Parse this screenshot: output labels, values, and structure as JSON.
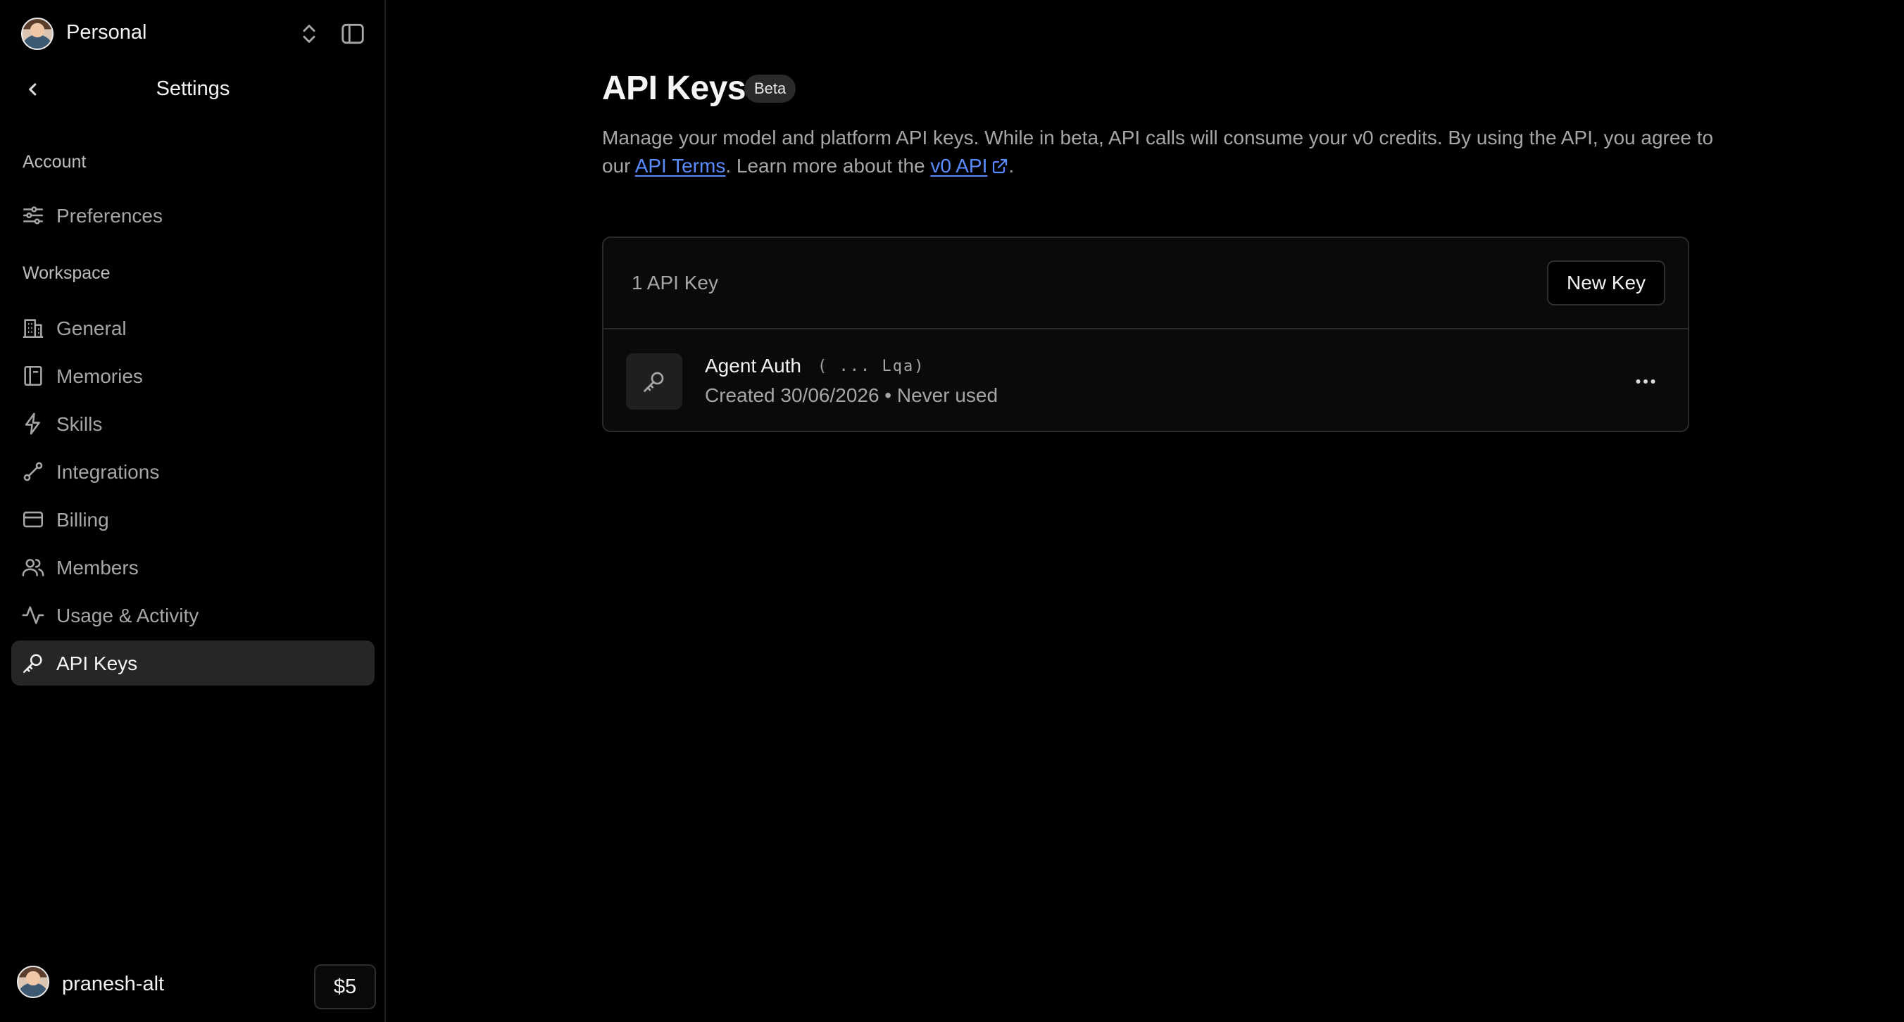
{
  "workspace": {
    "name": "Personal"
  },
  "settings": {
    "title": "Settings"
  },
  "sections": {
    "account": "Account",
    "workspace": "Workspace"
  },
  "nav": {
    "preferences": "Preferences",
    "general": "General",
    "memories": "Memories",
    "skills": "Skills",
    "integrations": "Integrations",
    "billing": "Billing",
    "members": "Members",
    "usage": "Usage & Activity",
    "api_keys": "API Keys"
  },
  "user": {
    "name": "pranesh-alt",
    "credits": "$5"
  },
  "page": {
    "title": "API Keys",
    "badge": "Beta",
    "desc_part1": "Manage your model and platform API keys. While in beta, API calls will consume your v0 credits. By using the API, you agree to our ",
    "link_terms": "API Terms",
    "desc_part2": ". Learn more about the ",
    "link_api": "v0 API",
    "desc_part3": "."
  },
  "keys": {
    "count_label": "1 API Key",
    "new_button": "New Key",
    "items": [
      {
        "name": "Agent Auth",
        "suffix": "( ... Lqa)",
        "meta": "Created 30/06/2026 • Never used"
      }
    ]
  },
  "icons": {
    "workspace_switch": "chevron-up-down-icon",
    "sidebar_toggle": "sidebar-panel-icon",
    "back": "chevron-left-icon",
    "preferences": "sliders-icon",
    "general": "building-icon",
    "memories": "book-icon",
    "skills": "lightning-icon",
    "integrations": "link-icon",
    "billing": "credit-card-icon",
    "members": "users-icon",
    "usage": "activity-icon",
    "api_keys": "key-icon",
    "external": "external-link-icon",
    "row_menu": "more-horizontal-icon"
  },
  "colors": {
    "background": "#000000",
    "link": "#5b8cff",
    "active_nav": "#262626"
  }
}
